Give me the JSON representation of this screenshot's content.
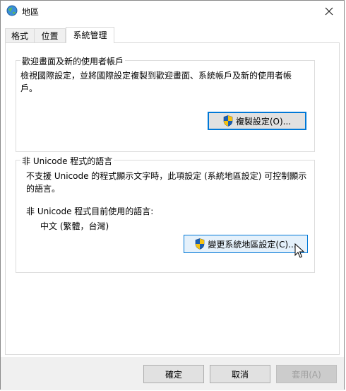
{
  "window": {
    "title": "地區"
  },
  "tabs": [
    {
      "label": "格式"
    },
    {
      "label": "位置"
    },
    {
      "label": "系統管理"
    }
  ],
  "welcome_group": {
    "title": "歡迎畫面及新的使用者帳戶",
    "description_line1": "檢視國際設定，並將國際設定複製到歡迎畫面、系統帳戶及新的使用者帳",
    "description_line2": "戶。",
    "copy_button": "複製設定(O)..."
  },
  "nonunicode_group": {
    "title": "非 Unicode 程式的語言",
    "description_line1": "不支援 Unicode 的程式顯示文字時，此項設定 (系統地區設定) 可控制顯示",
    "description_line2": "的語言。",
    "current_label": "非 Unicode 程式目前使用的語言:",
    "current_value": "中文 (繁體，台灣)",
    "change_button": "變更系統地區設定(C)..."
  },
  "footer": {
    "ok": "確定",
    "cancel": "取消",
    "apply": "套用(A)"
  },
  "icons": {
    "title": "globe-icon",
    "close": "close-icon",
    "shield": "uac-shield-icon",
    "cursor": "mouse-cursor-icon"
  },
  "colors": {
    "accent": "#0078d7",
    "button_face": "#e1e1e1",
    "footer_bg": "#f0f0f0"
  }
}
